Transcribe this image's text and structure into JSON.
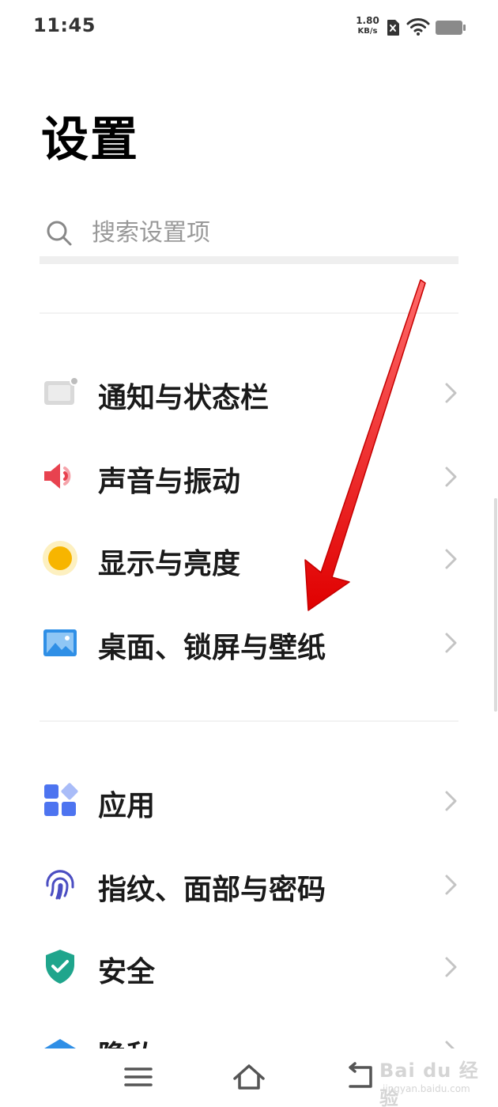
{
  "status_bar": {
    "time": "11:45",
    "net_speed_value": "1.80",
    "net_speed_unit": "KB/s",
    "icons": [
      "sim-off-icon",
      "wifi-icon",
      "battery-icon"
    ]
  },
  "page": {
    "title": "设置"
  },
  "search": {
    "placeholder": "搜索设置项"
  },
  "settings_items": [
    {
      "label": "通知与状态栏",
      "icon": "notification-statusbar-icon"
    },
    {
      "label": "声音与振动",
      "icon": "speaker-icon"
    },
    {
      "label": "显示与亮度",
      "icon": "brightness-icon"
    },
    {
      "label": "桌面、锁屏与壁纸",
      "icon": "wallpaper-icon"
    },
    {
      "label": "应用",
      "icon": "apps-grid-icon"
    },
    {
      "label": "指纹、面部与密码",
      "icon": "fingerprint-icon"
    },
    {
      "label": "安全",
      "icon": "shield-check-icon"
    },
    {
      "label": "隐私",
      "icon": "privacy-icon"
    }
  ],
  "nav_bar": {
    "icons": [
      "menu-icon",
      "home-icon",
      "back-icon"
    ]
  },
  "watermark": {
    "text": "Bai du 经验",
    "sub": "jingyan.baidu.com"
  },
  "colors": {
    "accent_red": "#e8424f",
    "brightness_yellow": "#f7b500",
    "wallpaper_blue": "#2f8fe6",
    "apps_blue": "#4d74f0",
    "fingerprint_indigo": "#4b4ec2",
    "shield_teal": "#1fa58c",
    "annotation_red": "#ff1a1a"
  }
}
